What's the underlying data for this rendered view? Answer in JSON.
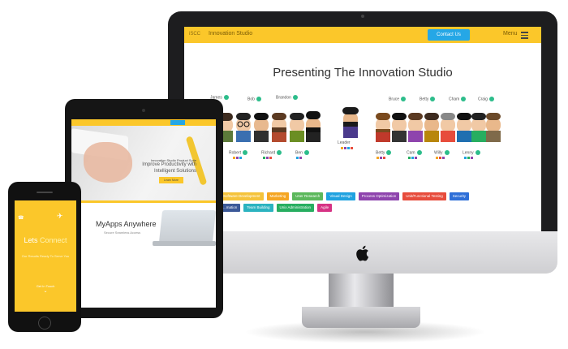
{
  "imac": {
    "nav": {
      "logo_text": "iSCC",
      "brand": "Innovation Studio",
      "contact_button": "Contact Us",
      "menu_label": "Menu"
    },
    "hero_title": "Presenting The Innovation Studio",
    "team_top_left": [
      "James",
      "Bob",
      "Brandon"
    ],
    "team_bottom_left": [
      "Robert",
      "Richard",
      "Ben"
    ],
    "leader_label": "Leader",
    "team_top_right": [
      "Bruce",
      "Betty",
      "Cham",
      "Craig"
    ],
    "team_bottom_right": [
      "Betty",
      "Cam",
      "Willy",
      "Lenny"
    ],
    "tags_row1": [
      {
        "label": "Software Development",
        "color": "#f5c33b"
      },
      {
        "label": "Marketing",
        "color": "#f5a623"
      },
      {
        "label": "User Research",
        "color": "#5cb85c"
      },
      {
        "label": "Visual Design",
        "color": "#1fa2e0"
      },
      {
        "label": "Process Optimization",
        "color": "#8e44ad"
      },
      {
        "label": "Unit/Functional Testing",
        "color": "#e74c3c"
      },
      {
        "label": "Security",
        "color": "#2e6fd8"
      }
    ],
    "tags_row2": [
      {
        "label": "...mation",
        "color": "#3b5998"
      },
      {
        "label": "Team Building",
        "color": "#2bb3c0"
      },
      {
        "label": "Unix Administration",
        "color": "#27ae60"
      },
      {
        "label": "Agile",
        "color": "#d63384"
      }
    ]
  },
  "ipad": {
    "nav_button": "",
    "hero_lines": [
      "Innovation Studio Product Suite",
      "Improve Productivity with",
      "Intelligent Solutions"
    ],
    "hero_button": "Learn More",
    "section_title": "MyApps Anywhere",
    "section_sub": "Secure Seamless Access"
  },
  "iphone": {
    "title_part1": "Lets",
    "title_part2": "Connect",
    "sub": "Our Results Ready To Serve You",
    "cta": "Get In Touch"
  }
}
